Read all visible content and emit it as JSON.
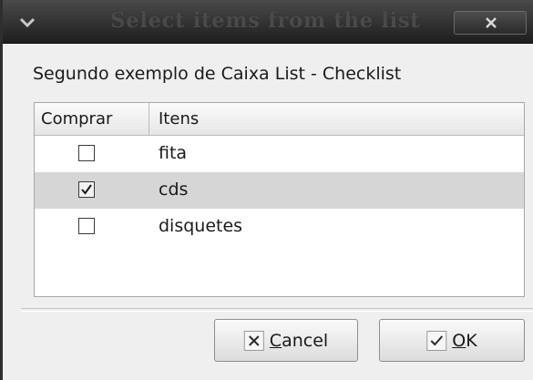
{
  "window": {
    "title": "Select items from the list"
  },
  "dialog": {
    "prompt": "Segundo exemplo de Caixa List - Checklist"
  },
  "list": {
    "columns": [
      "Comprar",
      "Itens"
    ],
    "rows": [
      {
        "checked": false,
        "label": "fita"
      },
      {
        "checked": true,
        "label": "cds",
        "selected": true
      },
      {
        "checked": false,
        "label": "disquetes"
      }
    ]
  },
  "buttons": {
    "cancel": {
      "mnemonic": "C",
      "rest": "ancel",
      "icon": "x-icon"
    },
    "ok": {
      "mnemonic": "O",
      "rest": "K",
      "icon": "check-icon"
    }
  },
  "icons": {
    "window_menu": "chevron-down-icon",
    "window_close": "close-icon"
  },
  "colors": {
    "titlebar": "#2a2a2a",
    "selection": "#d6d6d6",
    "dialog_bg": "#efefef"
  }
}
